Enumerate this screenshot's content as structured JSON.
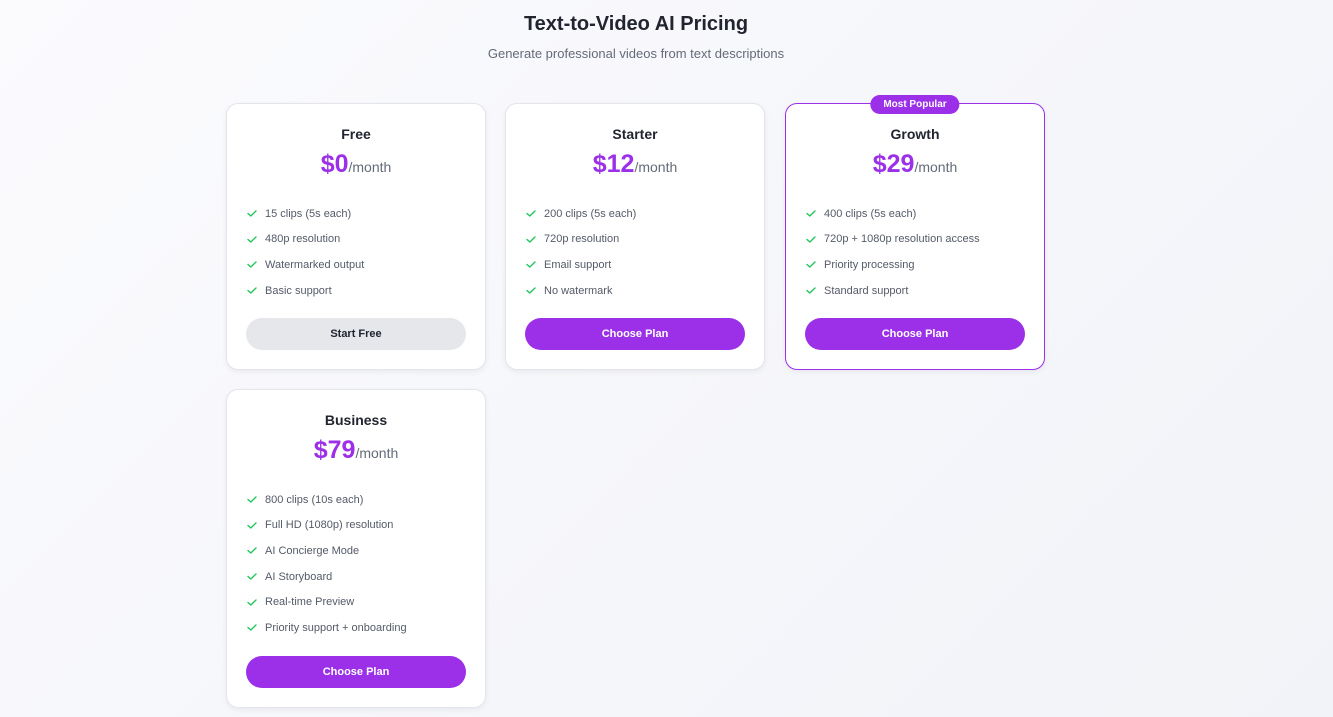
{
  "header": {
    "title": "Text-to-Video AI Pricing",
    "subtitle": "Generate professional videos from text descriptions"
  },
  "colors": {
    "accent": "#9b30e8",
    "check": "#22c55e",
    "secondary_button": "#e5e7eb"
  },
  "plans": [
    {
      "name": "Free",
      "price": "$0",
      "period": "/month",
      "features": [
        "15 clips (5s each)",
        "480p resolution",
        "Watermarked output",
        "Basic support"
      ],
      "cta": "Start Free"
    },
    {
      "name": "Starter",
      "price": "$12",
      "period": "/month",
      "features": [
        "200 clips (5s each)",
        "720p resolution",
        "Email support",
        "No watermark"
      ],
      "cta": "Choose Plan"
    },
    {
      "name": "Growth",
      "badge": "Most Popular",
      "price": "$29",
      "period": "/month",
      "features": [
        "400 clips (5s each)",
        "720p + 1080p resolution access",
        "Priority processing",
        "Standard support"
      ],
      "cta": "Choose Plan"
    },
    {
      "name": "Business",
      "price": "$79",
      "period": "/month",
      "features": [
        "800 clips (10s each)",
        "Full HD (1080p) resolution",
        "AI Concierge Mode",
        "AI Storyboard",
        "Real-time Preview",
        "Priority support + onboarding"
      ],
      "cta": "Choose Plan"
    }
  ]
}
